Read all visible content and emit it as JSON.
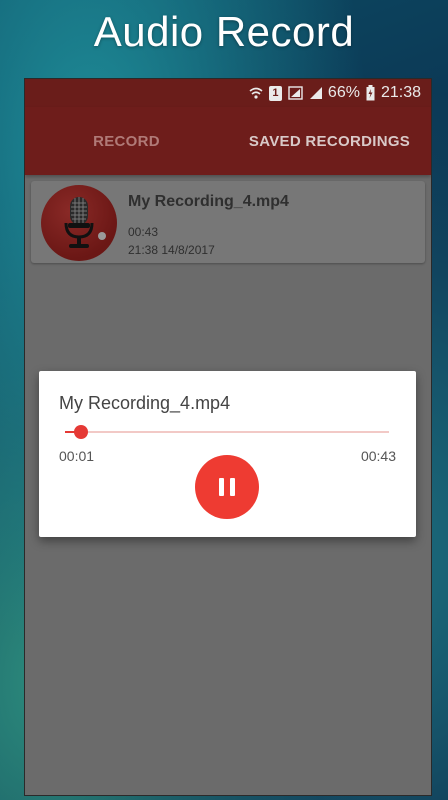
{
  "promo": {
    "title": "Audio Record"
  },
  "status_bar": {
    "sim_badge": "1",
    "battery": "66%",
    "time": "21:38",
    "icons": [
      "wifi-icon",
      "sim-icon",
      "signal-icon",
      "signal-icon",
      "battery-charging-icon"
    ]
  },
  "tabs": [
    {
      "label": "RECORD",
      "active": false
    },
    {
      "label": "SAVED RECORDINGS",
      "active": true
    }
  ],
  "recordings": [
    {
      "name": "My Recording_4.mp4",
      "duration": "00:43",
      "date": "21:38 14/8/2017",
      "icon": "microphone-icon"
    }
  ],
  "player_dialog": {
    "title": "My Recording_4.mp4",
    "current_time": "00:01",
    "total_time": "00:43",
    "progress": 0.05,
    "control_icon": "pause-icon"
  },
  "colors": {
    "app_bar": "#6e1d1b",
    "accent": "#e53935",
    "dim_overlay": "#6b6b6b"
  }
}
